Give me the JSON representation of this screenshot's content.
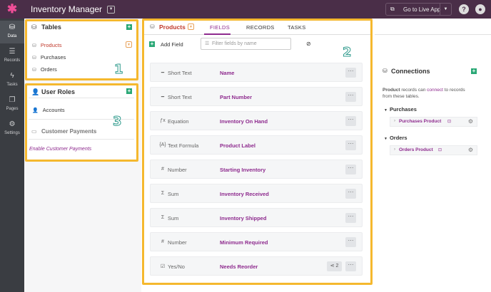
{
  "topbar": {
    "app_title": "Inventory Manager",
    "live_app_label": "Go to Live App",
    "help_icon": "?",
    "user_icon": "user-circle"
  },
  "leftnav": {
    "items": [
      {
        "label": "Data",
        "icon": "data-icon",
        "active": true
      },
      {
        "label": "Records",
        "icon": "records-icon"
      },
      {
        "label": "Tasks",
        "icon": "tasks-icon"
      },
      {
        "label": "Pages",
        "icon": "pages-icon"
      },
      {
        "label": "Settings",
        "icon": "settings-icon"
      }
    ]
  },
  "tables": {
    "title": "Tables",
    "items": [
      {
        "label": "Products",
        "active": true
      },
      {
        "label": "Purchases"
      },
      {
        "label": "Orders"
      }
    ]
  },
  "roles": {
    "title": "User Roles",
    "items": [
      {
        "label": "Accounts"
      }
    ],
    "customer_payments": "Customer Payments",
    "enable_link": "Enable Customer Payments"
  },
  "center": {
    "object_name": "Products",
    "tabs": [
      "FIELDS",
      "RECORDS",
      "TASKS"
    ],
    "active_tab": "FIELDS",
    "add_field": "Add Field",
    "filter_placeholder": "Filter fields by name",
    "fields": [
      {
        "type": "Short Text",
        "type_icon": "text-icon",
        "name": "Name"
      },
      {
        "type": "Short Text",
        "type_icon": "text-icon",
        "name": "Part Number"
      },
      {
        "type": "Equation",
        "type_icon": "equation-icon",
        "name": "Inventory On Hand"
      },
      {
        "type": "Text Formula",
        "type_icon": "formula-icon",
        "name": "Product Label"
      },
      {
        "type": "Number",
        "type_icon": "hash-icon",
        "name": "Starting Inventory"
      },
      {
        "type": "Sum",
        "type_icon": "sigma-icon",
        "name": "Inventory Received"
      },
      {
        "type": "Sum",
        "type_icon": "sigma-icon",
        "name": "Inventory Shipped"
      },
      {
        "type": "Number",
        "type_icon": "hash-icon",
        "name": "Minimum Required"
      },
      {
        "type": "Yes/No",
        "type_icon": "checkbox-icon",
        "name": "Needs Reorder",
        "connections": "2"
      }
    ]
  },
  "connections": {
    "title": "Connections",
    "desc_object": "Product",
    "desc_mid": " records can ",
    "desc_link": "connect",
    "desc_end": " to records from these tables.",
    "groups": [
      {
        "name": "Purchases",
        "item": "Purchases Product"
      },
      {
        "name": "Orders",
        "item": "Orders Product"
      }
    ]
  },
  "callouts": [
    "1",
    "2",
    "3"
  ],
  "colors": {
    "topbar": "#4a2e48",
    "accent": "#8e2b8e",
    "highlight": "#f5b82e",
    "add": "#2aa876",
    "active_table": "#c0392b"
  }
}
